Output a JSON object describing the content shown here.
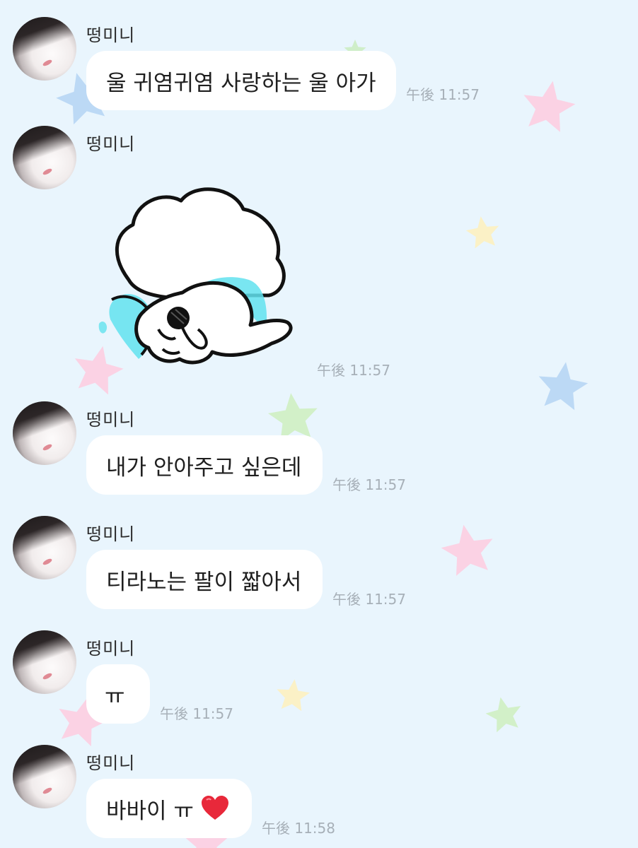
{
  "chat": {
    "sender_name": "떵미니",
    "messages": [
      {
        "text": "울 귀염귀염 사랑하는 울 아가",
        "time": "午後 11:57"
      },
      {
        "type": "sticker",
        "sticker_icon": "crying-fluffy-sheep-icon",
        "time": "午後 11:57"
      },
      {
        "text": "내가 안아주고 싶은데",
        "time": "午後 11:57"
      },
      {
        "text": "티라노는 팔이 짧아서",
        "time": "午後 11:57"
      },
      {
        "text": "ㅠ",
        "time": "午後 11:57"
      },
      {
        "text": "바바이 ㅠ",
        "emoji": "heart-icon",
        "time": "午後 11:58"
      }
    ]
  },
  "theme": {
    "background": "#e9f5fd",
    "bubble": "#ffffff",
    "time_color": "#a7b0b8",
    "heart": "#e8283a",
    "sticker_tears": "#62e2ee"
  }
}
